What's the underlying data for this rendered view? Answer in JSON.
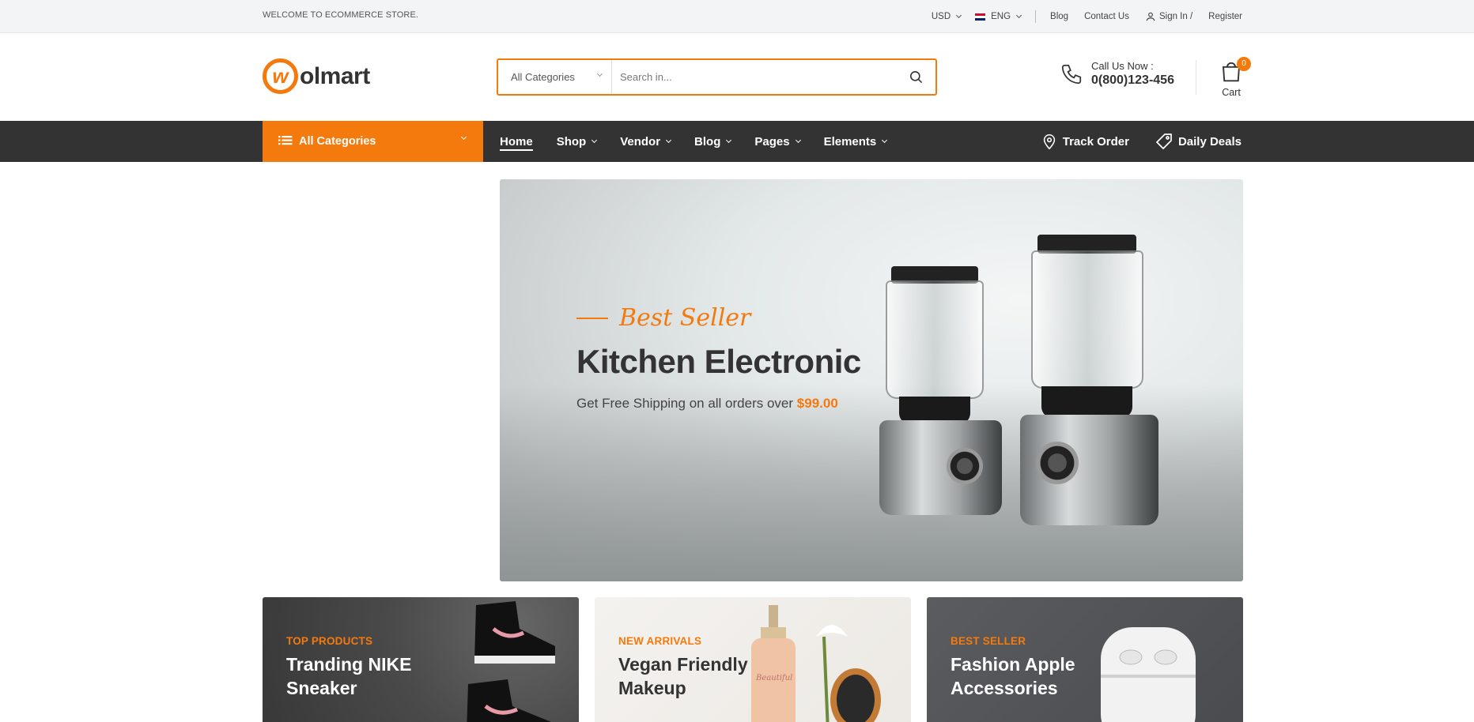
{
  "topbar": {
    "welcome": "WELCOME TO ECOMMERCE STORE.",
    "currency": "USD",
    "language": "ENG",
    "links": {
      "blog": "Blog",
      "contact": "Contact Us",
      "signin": "Sign In /",
      "register": "Register"
    }
  },
  "header": {
    "logo_mark": "w",
    "logo_text": "olmart",
    "search": {
      "category": "All Categories",
      "placeholder": "Search in..."
    },
    "call": {
      "label": "Call Us Now :",
      "number": "0(800)123-456"
    },
    "cart": {
      "label": "Cart",
      "count": "0"
    }
  },
  "nav": {
    "all_categories": "All Categories",
    "items": [
      {
        "label": "Home",
        "active": true
      },
      {
        "label": "Shop"
      },
      {
        "label": "Vendor"
      },
      {
        "label": "Blog"
      },
      {
        "label": "Pages"
      },
      {
        "label": "Elements"
      }
    ],
    "track_order": "Track Order",
    "daily_deals": "Daily Deals"
  },
  "banner": {
    "subtitle": "Best Seller",
    "title": "Kitchen Electronic",
    "desc_prefix": "Get Free Shipping on all orders over",
    "desc_price": "$99.00"
  },
  "cards": [
    {
      "tag": "TOP PRODUCTS",
      "title": "Tranding NIKE Sneaker"
    },
    {
      "tag": "NEW ARRIVALS",
      "title": "Vegan Friendly Makeup"
    },
    {
      "tag": "BEST SELLER",
      "title": "Fashion Apple Accessories"
    }
  ],
  "colors": {
    "accent": "#f47a0d",
    "nav_bg": "#333333",
    "topbar_bg": "#f3f4f6"
  }
}
